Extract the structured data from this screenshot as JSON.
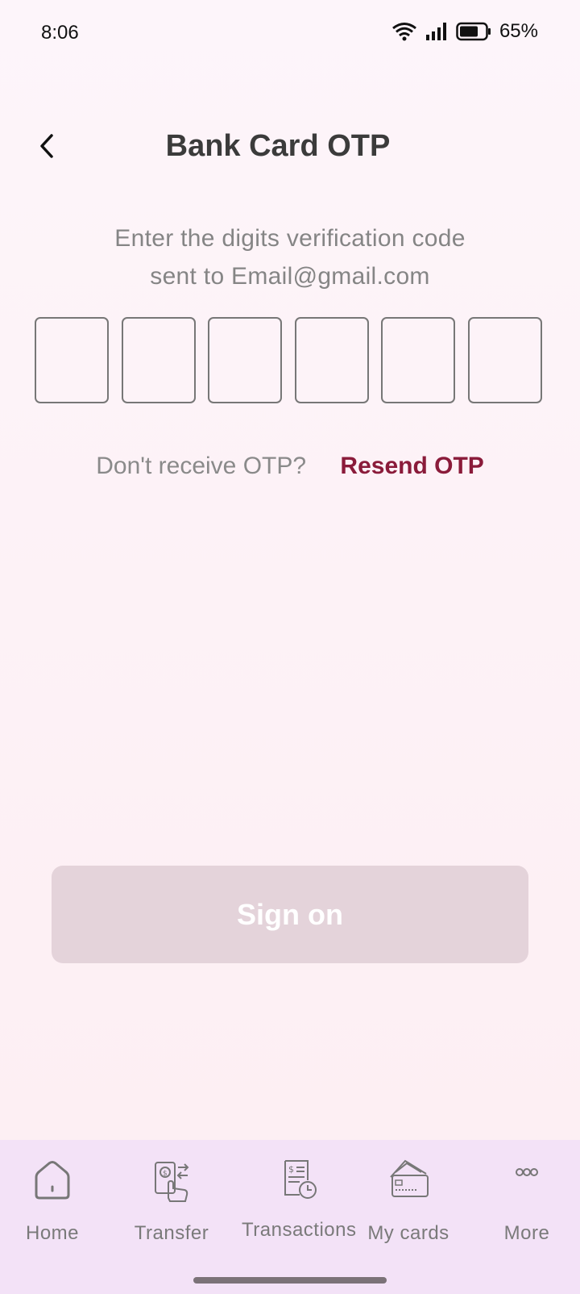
{
  "status_bar": {
    "time": "8:06",
    "battery": "65%"
  },
  "header": {
    "title": "Bank Card OTP"
  },
  "instructions": {
    "line1": "Enter the digits verification code",
    "line2": "sent to Email@gmail.com"
  },
  "otp": {
    "digits": [
      "",
      "",
      "",
      "",
      "",
      ""
    ]
  },
  "resend": {
    "question": "Don't receive OTP?",
    "link": "Resend OTP"
  },
  "primary_button": {
    "label": "Sign on",
    "enabled": false
  },
  "bottom_nav": {
    "items": [
      {
        "label": "Home",
        "icon": "home-icon"
      },
      {
        "label": "Transfer",
        "icon": "transfer-icon"
      },
      {
        "label": "Transactions",
        "icon": "transactions-icon"
      },
      {
        "label": "My cards",
        "icon": "cards-icon"
      },
      {
        "label": "More",
        "icon": "more-icon"
      }
    ]
  },
  "colors": {
    "accent": "#8a1b3a",
    "button_disabled": "#e4d3da",
    "nav_background": "#f3e2f7"
  }
}
